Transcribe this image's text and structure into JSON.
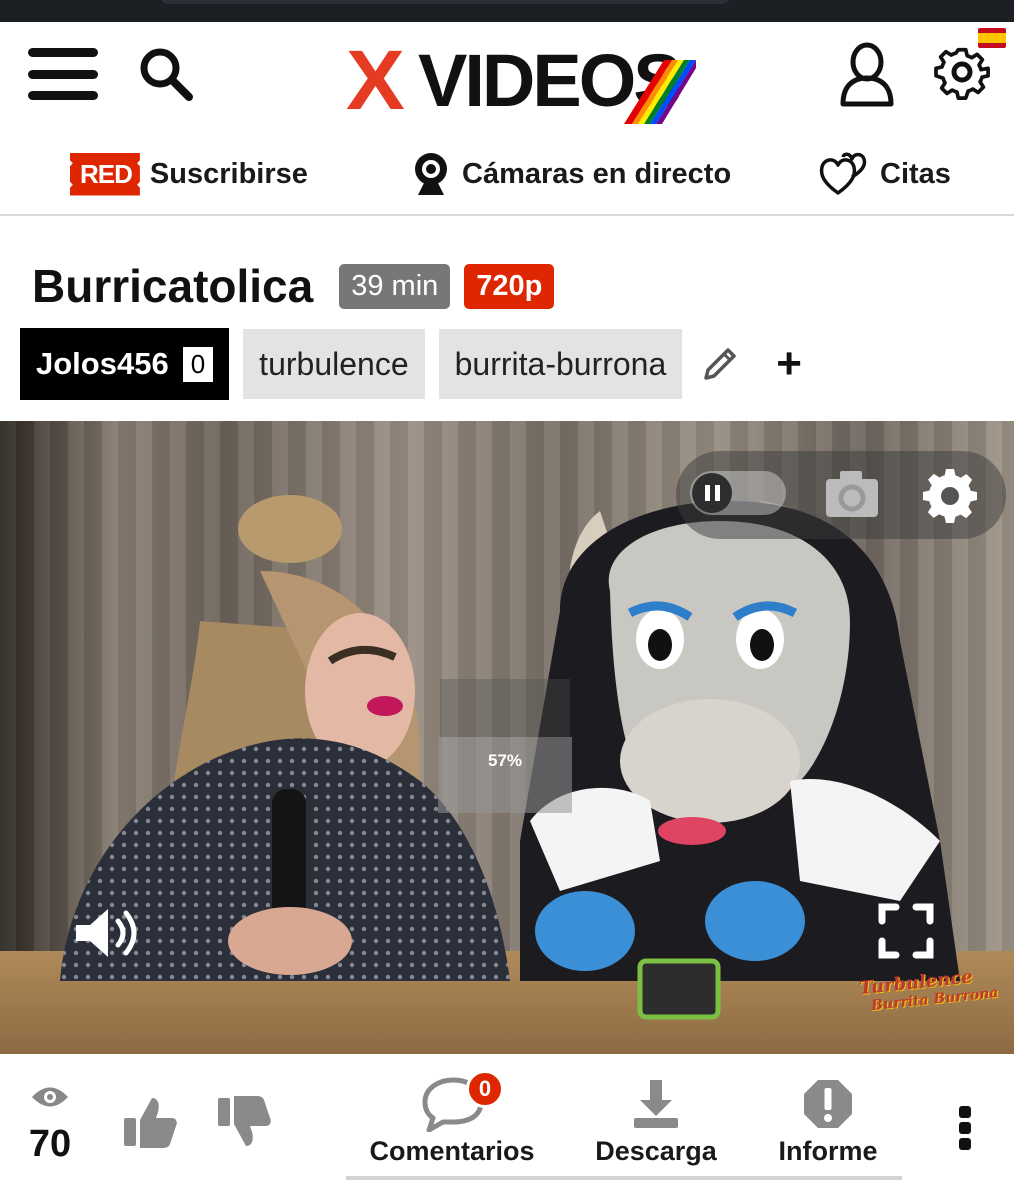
{
  "header": {
    "logo_text_x": "X",
    "logo_text_rest": "VIDEOS",
    "flag": "spain-flag",
    "icons": [
      "menu-icon",
      "search-icon",
      "user-icon",
      "gear-icon"
    ]
  },
  "nav": {
    "subscribe_badge": "RED",
    "subscribe_label": "Suscribirse",
    "cams_label": "Cámaras en directo",
    "dates_label": "Citas"
  },
  "video_info": {
    "title": "Burricatolica",
    "duration": "39 min",
    "resolution": "720p"
  },
  "tags": {
    "uploader": "Jolos456",
    "uploader_count": "0",
    "items": [
      "turbulence",
      "burrita-burrona"
    ],
    "add_label": "+"
  },
  "player": {
    "progress_label": "57%",
    "progress_value": 0.57,
    "watermark_line1": "Turbulence",
    "watermark_line2": "Burrita Burrona",
    "state": "playing"
  },
  "actions": {
    "views": "70",
    "comments_label": "Comentarios",
    "comments_count": "0",
    "download_label": "Descarga",
    "report_label": "Informe"
  },
  "colors": {
    "brand_red": "#de2600",
    "logo_red": "#e53b22",
    "tag_gray": "#e3e3e3",
    "duration_gray": "#777777"
  }
}
